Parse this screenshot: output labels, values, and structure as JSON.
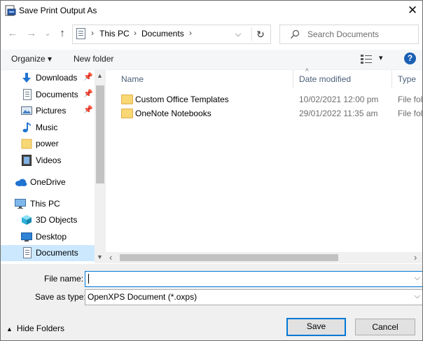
{
  "window": {
    "title": "Save Print Output As",
    "close_glyph": "✕"
  },
  "nav": {
    "back": "←",
    "forward": "→",
    "recent": "⌄",
    "up": "↑"
  },
  "address": {
    "breadcrumb_root_sep": "›",
    "crumbs": [
      "This PC",
      "Documents"
    ],
    "sep": "›",
    "dropdown": "⌵",
    "refresh": "↻"
  },
  "search": {
    "placeholder": "Search Documents"
  },
  "toolbar": {
    "organize": "Organize ▾",
    "new_folder": "New folder",
    "view_drop": "▾",
    "help": "?"
  },
  "sidebar": {
    "items": [
      {
        "label": "Downloads",
        "icon": "download-arrow-icon",
        "pinned": true
      },
      {
        "label": "Documents",
        "icon": "document-icon",
        "pinned": true
      },
      {
        "label": "Pictures",
        "icon": "pictures-icon",
        "pinned": true
      },
      {
        "label": "Music",
        "icon": "music-note-icon",
        "pinned": false
      },
      {
        "label": "power",
        "icon": "folder-icon",
        "pinned": false
      },
      {
        "label": "Videos",
        "icon": "video-icon",
        "pinned": false
      },
      {
        "label": "OneDrive",
        "icon": "cloud-icon",
        "pinned": false
      },
      {
        "label": "This PC",
        "icon": "monitor-icon",
        "pinned": false
      },
      {
        "label": "3D Objects",
        "icon": "cube-icon",
        "pinned": false
      },
      {
        "label": "Desktop",
        "icon": "desktop-icon",
        "pinned": false
      },
      {
        "label": "Documents",
        "icon": "document-icon",
        "pinned": false,
        "selected": true
      }
    ],
    "pin_glyph": "📌",
    "scroll_up": "▲",
    "scroll_down": "▼"
  },
  "columns": {
    "name": "Name",
    "date": "Date modified",
    "type": "Type",
    "sort_glyph": "^"
  },
  "files": [
    {
      "name": "Custom Office Templates",
      "date": "10/02/2021 12:00 pm",
      "type": "File folder"
    },
    {
      "name": "OneNote Notebooks",
      "date": "29/01/2022 11:35 am",
      "type": "File folder"
    }
  ],
  "hscroll": {
    "left": "‹",
    "right": "›"
  },
  "form": {
    "file_name_label": "File name:",
    "file_name_value": "",
    "save_type_label": "Save as type:",
    "save_type_value": "OpenXPS Document (*.oxps)",
    "dropdown": "⌵"
  },
  "footer": {
    "hide_folders": "Hide Folders",
    "hide_glyph": "▲",
    "save": "Save",
    "cancel": "Cancel"
  },
  "colors": {
    "accent": "#0078d7",
    "selection": "#cce8ff",
    "help": "#1a5fb4"
  }
}
